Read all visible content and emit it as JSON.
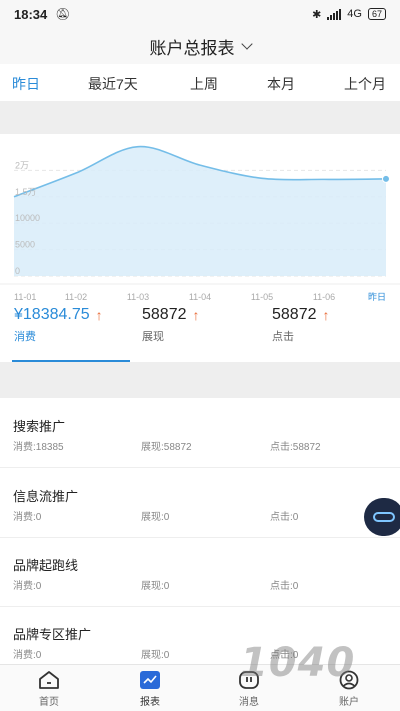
{
  "status_bar": {
    "time": "18:34",
    "network": "4G",
    "battery": "67"
  },
  "header": {
    "title": "账户总报表"
  },
  "tabs": [
    {
      "label": "昨日",
      "active": true
    },
    {
      "label": "最近7天",
      "active": false
    },
    {
      "label": "上周",
      "active": false
    },
    {
      "label": "本月",
      "active": false
    },
    {
      "label": "上个月",
      "active": false
    }
  ],
  "chart_data": {
    "type": "area",
    "x": [
      "11-01",
      "11-02",
      "11-03",
      "11-04",
      "11-05",
      "11-06",
      "昨日"
    ],
    "values": [
      15000,
      19500,
      24500,
      21000,
      18500,
      18300,
      18384.75
    ],
    "ylim": [
      0,
      25000
    ],
    "y_ticks": [
      "0",
      "5000",
      "10000",
      "1.5万",
      "2万"
    ],
    "grid": true,
    "colors": {
      "line": "#74bde8",
      "fill": "#d8ecf9"
    }
  },
  "metrics": [
    {
      "value": "¥18384.75",
      "label": "消费",
      "active": true
    },
    {
      "value": "58872",
      "label": "展现",
      "active": false
    },
    {
      "value": "58872",
      "label": "点击",
      "active": false
    }
  ],
  "list": [
    {
      "name": "搜索推广",
      "spend": "消费:18385",
      "impressions": "展现:58872",
      "clicks": "点击:58872"
    },
    {
      "name": "信息流推广",
      "spend": "消费:0",
      "impressions": "展现:0",
      "clicks": "点击:0"
    },
    {
      "name": "品牌起跑线",
      "spend": "消费:0",
      "impressions": "展现:0",
      "clicks": "点击:0"
    },
    {
      "name": "品牌专区推广",
      "spend": "消费:0",
      "impressions": "展现:0",
      "clicks": "点击:0"
    }
  ],
  "nav": [
    {
      "label": "首页",
      "icon": "home-icon"
    },
    {
      "label": "报表",
      "icon": "report-icon"
    },
    {
      "label": "消息",
      "icon": "message-icon"
    },
    {
      "label": "账户",
      "icon": "account-icon"
    }
  ],
  "watermark": "1040",
  "colors": {
    "accent": "#2a8bd8",
    "up_arrow": "#e96d3a"
  }
}
